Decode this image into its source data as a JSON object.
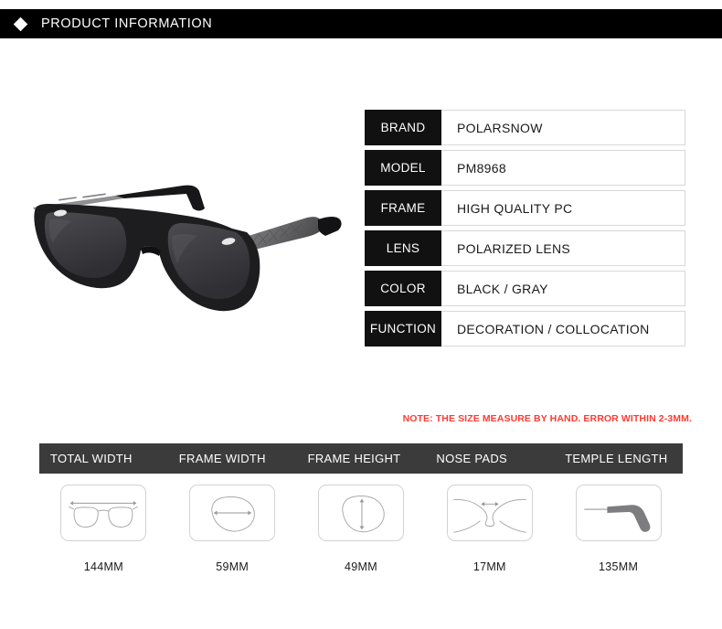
{
  "header": {
    "bullet_icon": "diamond-icon",
    "title": "PRODUCT INFORMATION"
  },
  "product_photo": {
    "alt": "black-wayfarer-sunglasses-photo",
    "frame_color": "#1a1a1a",
    "lens_color": "#3a3a3e",
    "temple_color": "#6e6e70"
  },
  "spec_table": {
    "rows": [
      {
        "label": "BRAND",
        "value": "POLARSNOW"
      },
      {
        "label": "MODEL",
        "value": "PM8968"
      },
      {
        "label": "FRAME",
        "value": "HIGH QUALITY PC"
      },
      {
        "label": "LENS",
        "value": "POLARIZED LENS"
      },
      {
        "label": "COLOR",
        "value": "BLACK / GRAY"
      },
      {
        "label": "FUNCTION",
        "value": "DECORATION / COLLOCATION"
      }
    ]
  },
  "note": {
    "text": "NOTE: THE SIZE MEASURE BY HAND. ERROR WITHIN 2-3MM.",
    "color": "#fc3b34"
  },
  "measurements": {
    "bar_color": "#3b3b3b",
    "columns": [
      {
        "header": "TOTAL WIDTH",
        "value": "144MM",
        "icon": "total-width-diagram-icon"
      },
      {
        "header": "FRAME WIDTH",
        "value": "59MM",
        "icon": "frame-width-diagram-icon"
      },
      {
        "header": "FRAME HEIGHT",
        "value": "49MM",
        "icon": "frame-height-diagram-icon"
      },
      {
        "header": "NOSE PADS",
        "value": "17MM",
        "icon": "nose-pads-diagram-icon"
      },
      {
        "header": "TEMPLE LENGTH",
        "value": "135MM",
        "icon": "temple-length-diagram-icon"
      }
    ]
  }
}
